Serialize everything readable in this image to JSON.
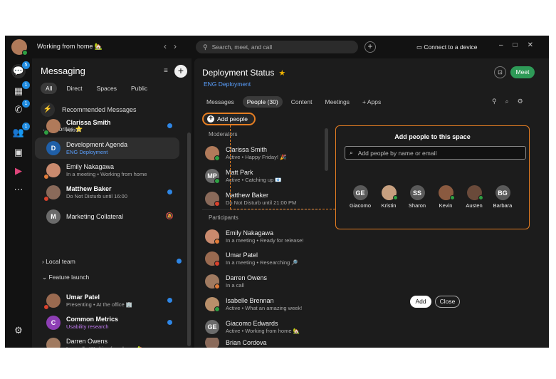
{
  "titlebar": {
    "status": "Working from home 🏡",
    "search_placeholder": "Search, meet, and call",
    "connect": "Connect to a device"
  },
  "rail": {
    "messaging_badge": "5",
    "calendar_badge": "1",
    "calls_badge": "1",
    "teams_badge": "1"
  },
  "messaging": {
    "title": "Messaging",
    "filters": [
      "All",
      "Direct",
      "Spaces",
      "Public"
    ],
    "recommended": "Recommended Messages",
    "favorites": "Favorites ⭐",
    "local_team": "Local team",
    "feature_launch": "Feature launch",
    "items": [
      {
        "initials": "",
        "name": "Clarissa Smith",
        "sub": "Active",
        "color": "#b07a5a",
        "status": "#2ea043",
        "bold": true,
        "unread": true
      },
      {
        "initials": "D",
        "name": "Development Agenda",
        "sub": "ENG Deployment",
        "color": "#1f5fa8",
        "status": "",
        "bold": false,
        "unread": false
      },
      {
        "initials": "",
        "name": "Emily Nakagawa",
        "sub": "In a meeting  •  Working from home",
        "color": "#c98a6e",
        "status": "#e07b39",
        "bold": false,
        "unread": false
      },
      {
        "initials": "",
        "name": "Matthew Baker",
        "sub": "Do Not Disturb until 16:00",
        "color": "#8a6a5a",
        "status": "#d9412c",
        "bold": true,
        "unread": true
      },
      {
        "initials": "M",
        "name": "Marketing Collateral",
        "sub": "",
        "color": "#6b6b6b",
        "status": "",
        "bold": false,
        "unread": false
      },
      {
        "initials": "",
        "name": "Umar Patel",
        "sub": "Presenting  •  At the office 🏢",
        "color": "#9a6a50",
        "status": "#d9412c",
        "bold": true,
        "unread": true
      },
      {
        "initials": "C",
        "name": "Common Metrics",
        "sub": "Usability research",
        "color": "#8e3fb5",
        "status": "",
        "bold": true,
        "unread": true
      },
      {
        "initials": "",
        "name": "Darren Owens",
        "sub": "In a call  •  Working from home 🏡",
        "color": "#a07a60",
        "status": "#e07b39",
        "bold": false,
        "unread": false
      }
    ]
  },
  "space": {
    "title": "Deployment Status",
    "subtitle": "ENG Deployment",
    "meet": "Meet",
    "tabs": [
      "Messages",
      "People (30)",
      "Content",
      "Meetings",
      "+  Apps"
    ],
    "add_people": "Add people",
    "moderators_label": "Moderators",
    "participants_label": "Participants",
    "moderators": [
      {
        "initials": "",
        "name": "Clarissa Smith",
        "sub": "Active  •  Happy Friday! 🎉",
        "color": "#b07a5a",
        "status": "#2ea043"
      },
      {
        "initials": "MP",
        "name": "Matt Park",
        "sub": "Active  •  Catching up 📧",
        "color": "#6b6b6b",
        "status": "#2ea043"
      },
      {
        "initials": "",
        "name": "Matthew Baker",
        "sub": "Do Not Disturb until 21:00 PM",
        "color": "#8a6a5a",
        "status": "#d9412c"
      }
    ],
    "participants": [
      {
        "initials": "",
        "name": "Emily Nakagawa",
        "sub": "In a meeting  •  Ready for release!",
        "color": "#c98a6e",
        "status": "#e07b39"
      },
      {
        "initials": "",
        "name": "Umar Patel",
        "sub": "In a meeting  •  Researching 🔎",
        "color": "#9a6a50",
        "status": "#d9412c"
      },
      {
        "initials": "",
        "name": "Darren Owens",
        "sub": "In a call",
        "color": "#a07a60",
        "status": "#e07b39"
      },
      {
        "initials": "",
        "name": "Isabelle Brennan",
        "sub": "Active  •  What an amazing week!",
        "color": "#b88f6a",
        "status": "#2ea043"
      },
      {
        "initials": "GE",
        "name": "Giacomo Edwards",
        "sub": "Active  •  Working from home 🏡",
        "color": "#6b6b6b",
        "status": ""
      },
      {
        "initials": "",
        "name": "Brian Cordova",
        "sub": "",
        "color": "#8a6a5a",
        "status": ""
      }
    ]
  },
  "panel": {
    "title": "Add people to this space",
    "placeholder": "Add people by name or email",
    "suggestions": [
      {
        "initials": "GE",
        "name": "Giacomo",
        "color": "#5a5a5a",
        "online": false
      },
      {
        "initials": "",
        "name": "Kristin",
        "color": "#c7a080",
        "online": true
      },
      {
        "initials": "SS",
        "name": "Sharon",
        "color": "#5a5a5a",
        "online": false
      },
      {
        "initials": "",
        "name": "Kevin",
        "color": "#8a5a40",
        "online": true
      },
      {
        "initials": "",
        "name": "Austen",
        "color": "#6a4a3a",
        "online": true
      },
      {
        "initials": "BG",
        "name": "Barbara",
        "color": "#5a5a5a",
        "online": false
      }
    ],
    "add": "Add",
    "close": "Close"
  }
}
